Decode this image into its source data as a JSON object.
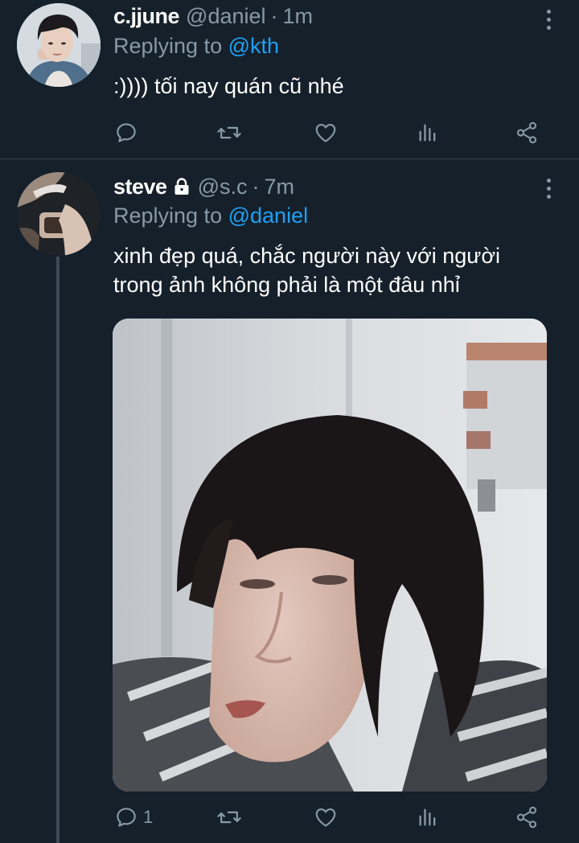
{
  "tweets": [
    {
      "name": "c.jjune",
      "handle": "@daniel",
      "separator": "·",
      "time": "1m",
      "replying_label": "Replying to",
      "replying_to": "@kth",
      "text_lines": [
        ":))))  tối nay quán cũ nhé"
      ],
      "reply_count": "",
      "icons": [
        "reply-icon",
        "retweet-icon",
        "like-icon",
        "analytics-icon",
        "share-icon"
      ]
    },
    {
      "name": "steve",
      "handle": "@s.c",
      "separator": "·",
      "time": "7m",
      "protected": true,
      "replying_label": "Replying to",
      "replying_to": "@daniel",
      "text_lines": [
        "xinh đẹp quá, chắc người này với người",
        "trong ảnh không phải là một đâu nhỉ"
      ],
      "has_media": true,
      "reply_count": "1",
      "icons": [
        "reply-icon",
        "retweet-icon",
        "like-icon",
        "analytics-icon",
        "share-icon"
      ]
    }
  ],
  "colors": {
    "background": "#15202b",
    "secondary_text": "#8899a6",
    "link": "#1da1f2",
    "divider": "#38444d"
  }
}
